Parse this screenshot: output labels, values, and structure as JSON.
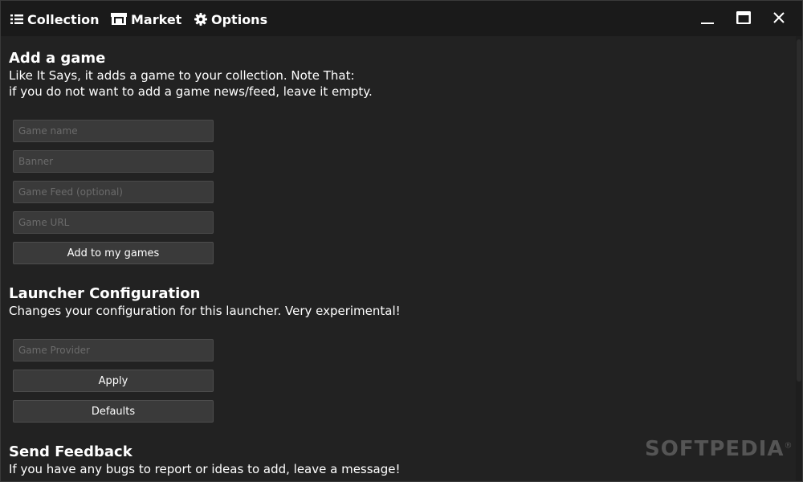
{
  "nav": {
    "collection": "Collection",
    "market": "Market",
    "options": "Options"
  },
  "add_game": {
    "title": "Add a game",
    "desc_line1": "Like It Says, it adds a game to your collection. Note That:",
    "desc_line2": "if you do not want to add a game news/feed, leave it empty.",
    "game_name_placeholder": "Game name",
    "banner_placeholder": "Banner",
    "feed_placeholder": "Game Feed (optional)",
    "url_placeholder": "Game URL",
    "add_button": "Add to my games"
  },
  "launcher_config": {
    "title": "Launcher Configuration",
    "desc": "Changes your configuration for this launcher. Very experimental!",
    "provider_placeholder": "Game Provider",
    "apply_button": "Apply",
    "defaults_button": "Defaults"
  },
  "feedback": {
    "title": "Send Feedback",
    "desc": "If you have any bugs to report or ideas to add, leave a message!"
  },
  "watermark": {
    "text": "SOFTPEDIA",
    "mark": "®"
  },
  "colors": {
    "background": "#222222",
    "titlebar": "#1a1a1a",
    "field": "#3a3a3a",
    "text": "#ffffff"
  }
}
